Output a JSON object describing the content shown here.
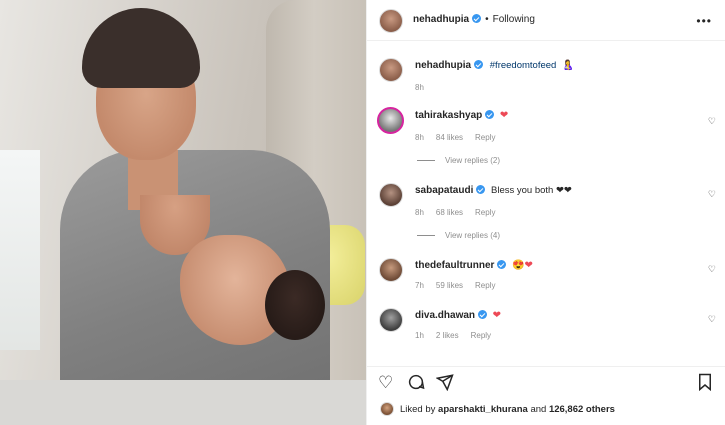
{
  "post": {
    "owner": "nehadhupia",
    "follow_status": "Following",
    "caption_hashtag": "#freedomtofeed",
    "caption_emoji": "🤱",
    "caption_time": "8h"
  },
  "comments": [
    {
      "user": "tahirakashyap",
      "text": "❤",
      "time": "8h",
      "likes": "84 likes",
      "reply": "Reply",
      "view_replies": "View replies (2)"
    },
    {
      "user": "sabapataudi",
      "text": "Bless you both ❤❤",
      "time": "8h",
      "likes": "68 likes",
      "reply": "Reply",
      "view_replies": "View replies (4)"
    },
    {
      "user": "thedefaultrunner",
      "text": "😍❤",
      "time": "7h",
      "likes": "59 likes",
      "reply": "Reply"
    },
    {
      "user": "diva.dhawan",
      "text": "❤",
      "time": "1h",
      "likes": "2 likes",
      "reply": "Reply"
    }
  ],
  "footer": {
    "liked_by_prefix": "Liked by",
    "liked_by_user": "aparshakti_khurana",
    "liked_by_suffix": "and",
    "liked_count": "126,862 others"
  },
  "icons": {
    "more": "more-icon",
    "like": "heart-icon",
    "comment": "comment-icon",
    "share": "share-icon",
    "save": "bookmark-icon"
  }
}
